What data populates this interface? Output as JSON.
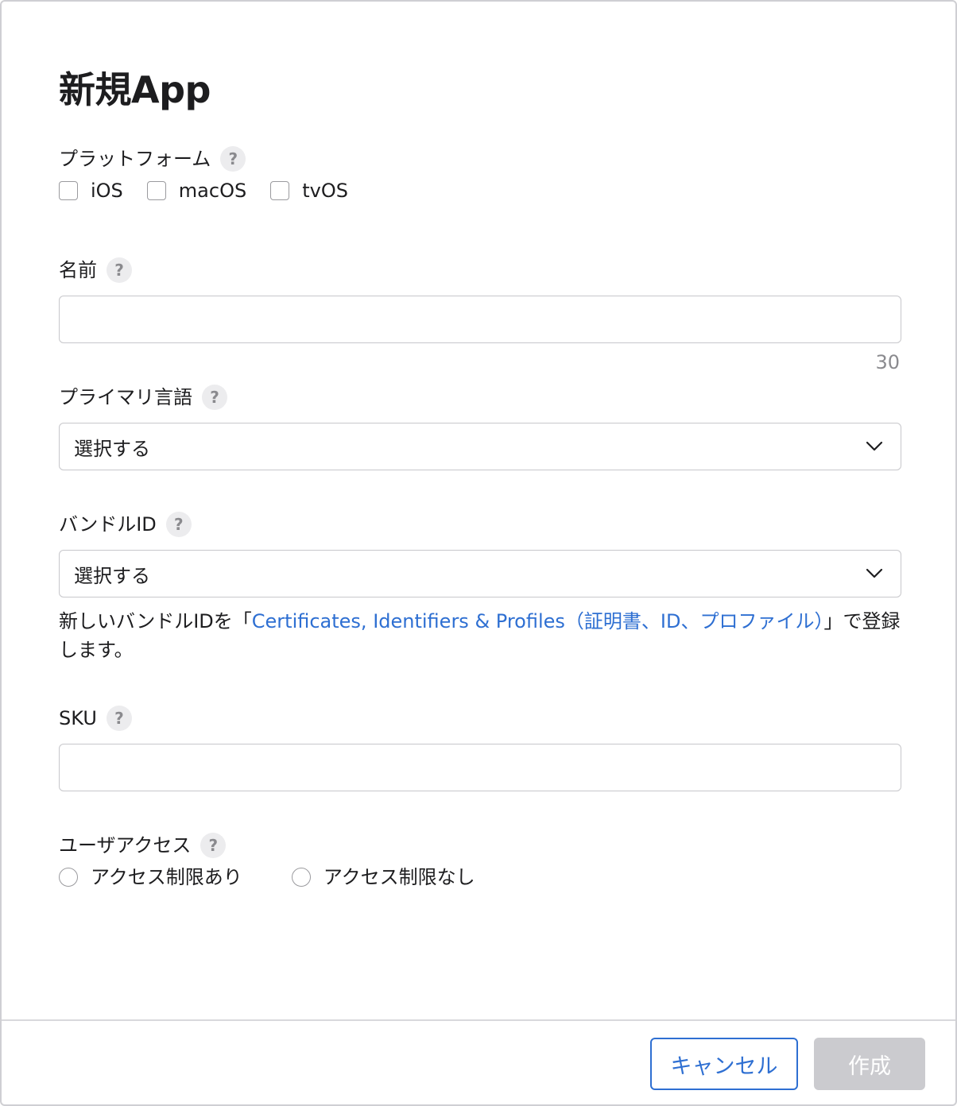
{
  "dialog": {
    "title": "新規App",
    "platform": {
      "label": "プラットフォーム",
      "help": "?",
      "options": [
        {
          "label": "iOS",
          "checked": false
        },
        {
          "label": "macOS",
          "checked": false
        },
        {
          "label": "tvOS",
          "checked": false
        }
      ]
    },
    "name": {
      "label": "名前",
      "help": "?",
      "value": "",
      "remaining": "30"
    },
    "primary_language": {
      "label": "プライマリ言語",
      "help": "?",
      "selected": "選択する",
      "icon": "chevron-down-icon"
    },
    "bundle_id": {
      "label": "バンドルID",
      "help": "?",
      "selected": "選択する",
      "icon": "chevron-down-icon",
      "note_before": "新しいバンドルIDを「",
      "note_link": "Certificates, Identifiers & Profiles（証明書、ID、プロファイル）",
      "note_after": "」で登録します。"
    },
    "sku": {
      "label": "SKU",
      "help": "?",
      "value": ""
    },
    "user_access": {
      "label": "ユーザアクセス",
      "help": "?",
      "options": [
        {
          "label": "アクセス制限あり",
          "selected": false
        },
        {
          "label": "アクセス制限なし",
          "selected": false
        }
      ]
    },
    "footer": {
      "cancel_label": "キャンセル",
      "create_label": "作成",
      "create_enabled": false
    }
  },
  "colors": {
    "accent": "#2e6fd2",
    "text": "#1d1d1f",
    "muted": "#8a8a8e",
    "disabled_button": "#cbcbcf",
    "border": "#c7c7cb"
  }
}
